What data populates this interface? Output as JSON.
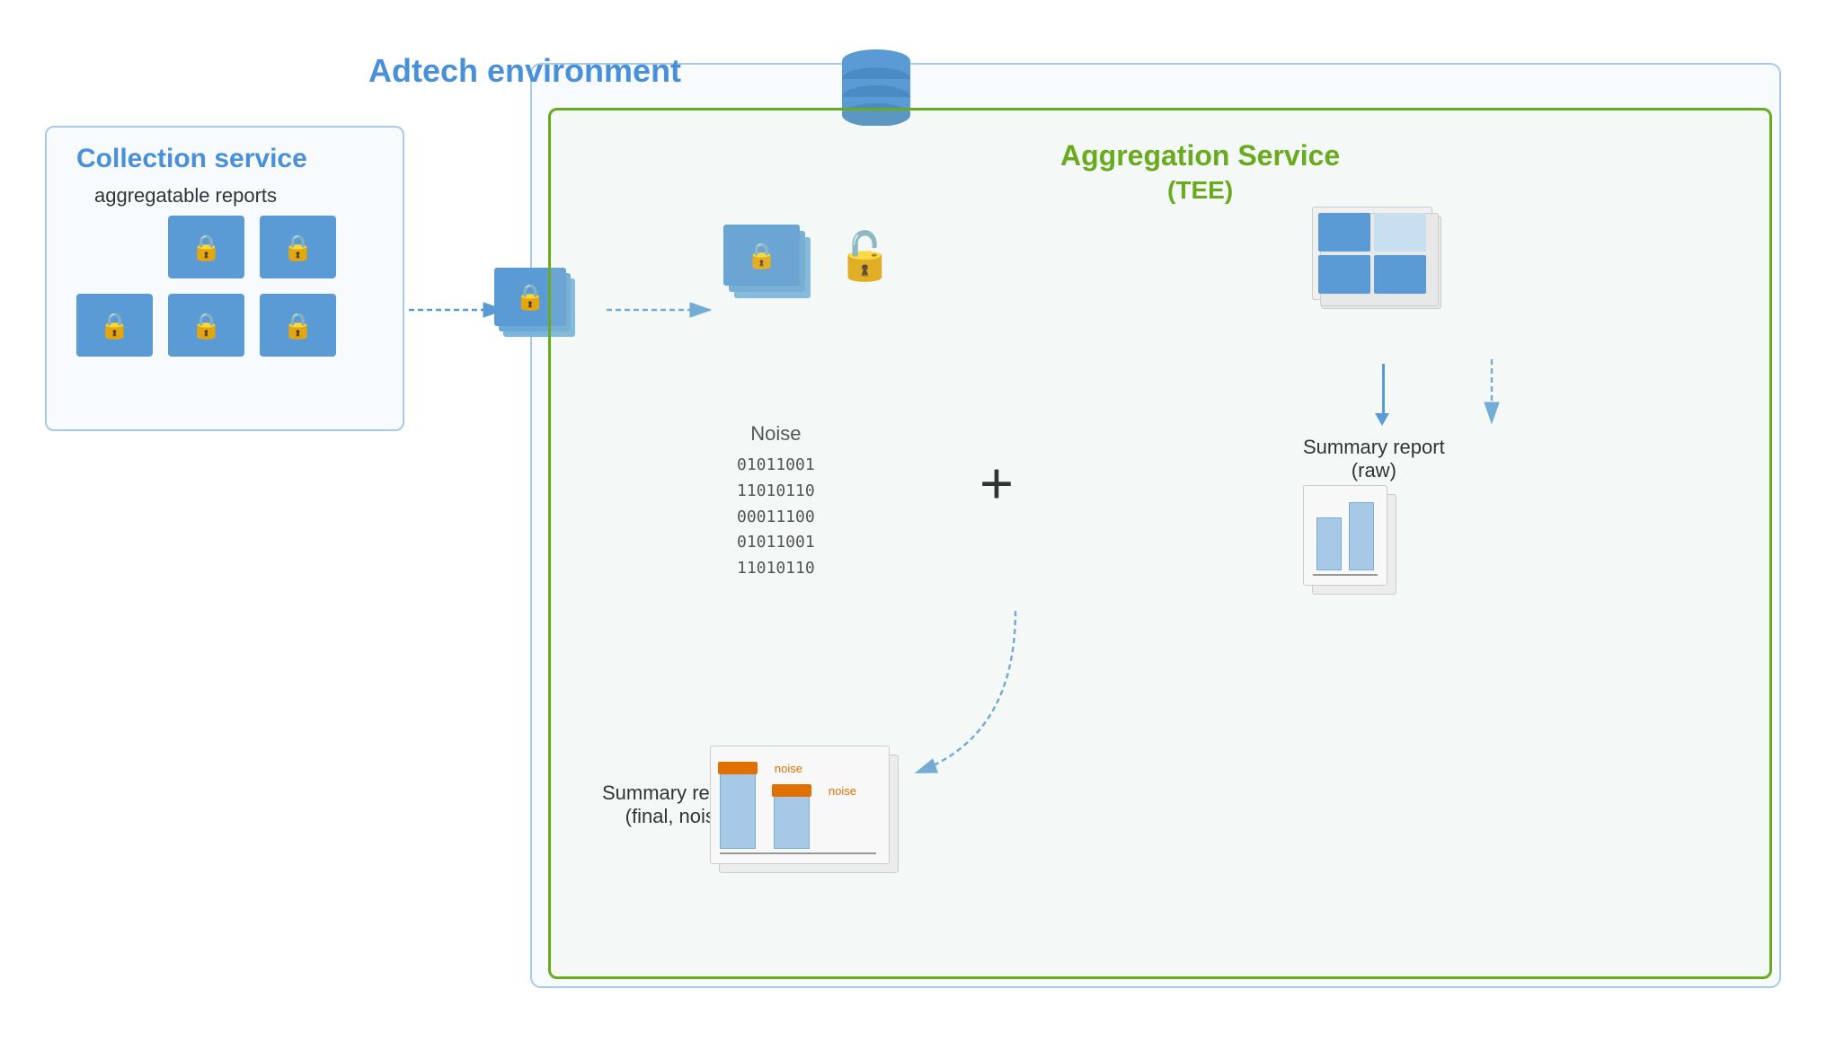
{
  "diagram": {
    "adtech_label": "Adtech environment",
    "collection_service_label": "Collection service",
    "collection_sublabel": "aggregatable reports",
    "aggregation_service_label": "Aggregation Service",
    "aggregation_service_sublabel": "(TEE)",
    "noise_label": "Noise",
    "noise_binary": [
      "01011001",
      "11010110",
      "00011100",
      "01011001",
      "11010110"
    ],
    "plus_symbol": "+",
    "summary_raw_label": "Summary report",
    "summary_raw_sublabel": "(raw)",
    "summary_final_label": "Summary report",
    "summary_final_sublabel": "(final, noised)",
    "noise_annotation_1": "noise",
    "noise_annotation_2": "noise",
    "lock_icon": "🔒",
    "unlock_icon": "🔓"
  }
}
